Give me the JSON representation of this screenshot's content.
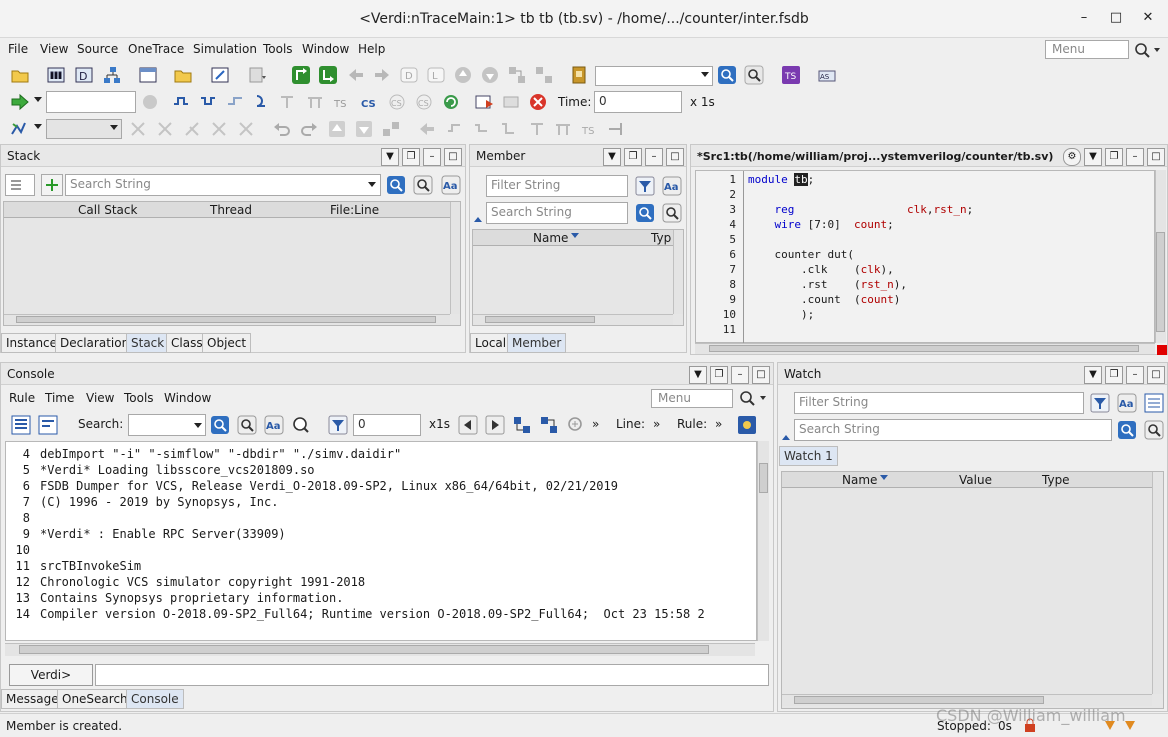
{
  "window": {
    "title": "<Verdi:nTraceMain:1> tb tb (tb.sv) - /home/.../counter/inter.fsdb"
  },
  "menu": {
    "items": [
      "File",
      "View",
      "Source",
      "OneTrace",
      "Simulation",
      "Tools",
      "Window",
      "Help"
    ],
    "search_placeholder": "Menu"
  },
  "toolbar2": {
    "time_label": "Time:",
    "time_value": "0",
    "time_unit": "x 1s"
  },
  "stack_panel": {
    "title": "Stack",
    "search_placeholder": "Search String",
    "columns": [
      "Call Stack",
      "Thread",
      "File:Line"
    ],
    "tabs": [
      "Instance",
      "Declaration",
      "Stack",
      "Class",
      "Object"
    ],
    "active_tab": "Stack"
  },
  "member_panel": {
    "title": "Member",
    "filter_placeholder": "Filter String",
    "search_placeholder": "Search String",
    "columns": [
      "Name",
      "Typ"
    ],
    "tabs": [
      "Local",
      "Member"
    ],
    "active_tab": "Member"
  },
  "source_panel": {
    "title": "*Src1:tb(/home/william/proj...ystemverilog/counter/tb.sv)",
    "lines": [
      {
        "n": "1",
        "parts": [
          {
            "t": "module ",
            "c": "kw"
          },
          {
            "t": "tb",
            "c": "sel"
          },
          {
            "t": ";",
            "c": ""
          }
        ]
      },
      {
        "n": "2",
        "parts": []
      },
      {
        "n": "3",
        "parts": [
          {
            "t": "    reg",
            "c": "kw"
          },
          {
            "t": "                 ",
            "c": ""
          },
          {
            "t": "clk",
            "c": "id"
          },
          {
            "t": ",",
            "c": ""
          },
          {
            "t": "rst_n",
            "c": "id"
          },
          {
            "t": ";",
            "c": ""
          }
        ]
      },
      {
        "n": "4",
        "parts": [
          {
            "t": "    wire",
            "c": "kw"
          },
          {
            "t": " [7:0]  ",
            "c": ""
          },
          {
            "t": "count",
            "c": "id"
          },
          {
            "t": ";",
            "c": ""
          }
        ]
      },
      {
        "n": "5",
        "parts": []
      },
      {
        "n": "6",
        "parts": [
          {
            "t": "    counter dut(",
            "c": ""
          }
        ]
      },
      {
        "n": "7",
        "parts": [
          {
            "t": "        .clk    (",
            "c": ""
          },
          {
            "t": "clk",
            "c": "id"
          },
          {
            "t": "),",
            "c": ""
          }
        ]
      },
      {
        "n": "8",
        "parts": [
          {
            "t": "        .rst    (",
            "c": ""
          },
          {
            "t": "rst_n",
            "c": "id"
          },
          {
            "t": "),",
            "c": ""
          }
        ]
      },
      {
        "n": "9",
        "parts": [
          {
            "t": "        .count  (",
            "c": ""
          },
          {
            "t": "count",
            "c": "id"
          },
          {
            "t": ")",
            "c": ""
          }
        ]
      },
      {
        "n": "10",
        "parts": [
          {
            "t": "        );",
            "c": ""
          }
        ]
      },
      {
        "n": "11",
        "parts": []
      }
    ]
  },
  "console_panel": {
    "title": "Console",
    "menu": [
      "Rule",
      "Time",
      "View",
      "Tools",
      "Window"
    ],
    "menu_search_placeholder": "Menu",
    "search_label": "Search:",
    "time_value": "0",
    "time_unit": "x1s",
    "line_label": "Line:",
    "rule_label": "Rule:",
    "lines": [
      {
        "n": "4",
        "t": "debImport \"-i\" \"-simflow\" \"-dbdir\" \"./simv.daidir\""
      },
      {
        "n": "5",
        "t": "*Verdi* Loading libsscore_vcs201809.so"
      },
      {
        "n": "6",
        "t": "FSDB Dumper for VCS, Release Verdi_O-2018.09-SP2, Linux x86_64/64bit, 02/21/2019"
      },
      {
        "n": "7",
        "t": "(C) 1996 - 2019 by Synopsys, Inc."
      },
      {
        "n": "8",
        "t": ""
      },
      {
        "n": "9",
        "t": "*Verdi* : Enable RPC Server(33909)"
      },
      {
        "n": "10",
        "t": ""
      },
      {
        "n": "11",
        "t": "srcTBInvokeSim"
      },
      {
        "n": "12",
        "t": "Chronologic VCS simulator copyright 1991-2018"
      },
      {
        "n": "13",
        "t": "Contains Synopsys proprietary information."
      },
      {
        "n": "14",
        "t": "Compiler version O-2018.09-SP2_Full64; Runtime version O-2018.09-SP2_Full64;  Oct 23 15:58 2"
      }
    ],
    "prompt_label": "Verdi>",
    "tabs": [
      "Message",
      "OneSearch",
      "Console"
    ],
    "active_tab": "Console"
  },
  "watch_panel": {
    "title": "Watch",
    "filter_placeholder": "Filter String",
    "search_placeholder": "Search String",
    "tab": "Watch 1",
    "columns": [
      "Name",
      "Value",
      "Type"
    ]
  },
  "status": {
    "message": "Member is created.",
    "stopped_label": "Stopped:",
    "stopped_value": "0s",
    "watermark": "CSDN @William_william"
  }
}
